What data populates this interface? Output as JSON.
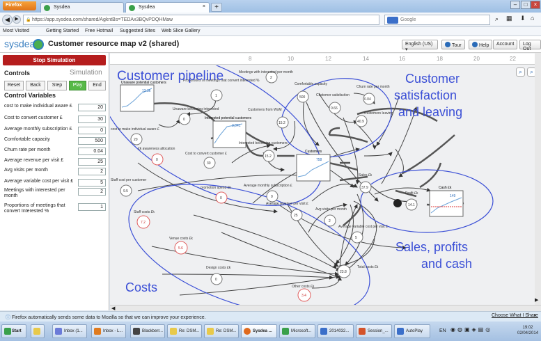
{
  "browser": {
    "app_button": "Firefox",
    "tabs": [
      {
        "label": "Sysdea"
      },
      {
        "label": "Sysdea"
      }
    ],
    "new_tab": "+",
    "url": "https://app.sysdea.com/shared/AgkntBs=TEDAx3BQvPDQHMaw",
    "search_placeholder": "Google",
    "bookmarks": [
      "Most Visited",
      "Getting Started",
      "Free Hotmail",
      "Suggested Sites",
      "Web Slice Gallery"
    ]
  },
  "app": {
    "logo": "sysdea",
    "title": "Customer resource map v2 (shared)",
    "language": "English (US)",
    "tour": "Tour",
    "help": "Help",
    "account": "Account",
    "logout": "Log Out"
  },
  "left": {
    "stop": "Stop Simulation",
    "controls": "Controls",
    "simulation": "Simulation",
    "sim_buttons": [
      "Reset",
      "Back",
      "Step",
      "Play",
      "End"
    ],
    "control_vars_title": "Control Variables",
    "variables": [
      {
        "label": "cost to make individual aware £",
        "value": "20"
      },
      {
        "label": "Cost to convert customer £",
        "value": "30"
      },
      {
        "label": "Average monthly subscription £",
        "value": "0"
      },
      {
        "label": "Comfortable capacity",
        "value": "500"
      },
      {
        "label": "Churn rate per month",
        "value": "0.04"
      },
      {
        "label": "Average revenue per visit £",
        "value": "25"
      },
      {
        "label": "Avg visits per month",
        "value": "2"
      },
      {
        "label": "Average variable cost per visit £",
        "value": "5"
      },
      {
        "label": "Meetings with interested per month",
        "value": "2"
      },
      {
        "label": "Proportions of meetings that convert Interested %",
        "value": "1"
      }
    ]
  },
  "ruler": [
    "8",
    "10",
    "12",
    "14",
    "16",
    "18",
    "20",
    "22"
  ],
  "annotations": {
    "pipeline": "Customer pipeline",
    "satisfaction": [
      "Customer",
      "satisfaction",
      "and leaving"
    ],
    "sales": [
      "Sales, profits",
      "and cash"
    ],
    "costs": "Costs"
  },
  "nodes": {
    "unaware": {
      "label": "Unaware potential customers",
      "value": "13.3k"
    },
    "interested": {
      "label": "Interested potential customers",
      "value": "3,041"
    },
    "customers": {
      "label": "Customers",
      "value": "758"
    },
    "cash": {
      "label": "Cash £k",
      "value": "149"
    },
    "proportion": {
      "label": "Proportions of meetings that convert interested %",
      "value": "1"
    },
    "meetings": {
      "label": "Meetings with interested per month",
      "value": "2"
    },
    "capacity": {
      "label": "Comfortable capacity",
      "value": "500"
    },
    "churn": {
      "label": "Churn rate per month",
      "value": "0.04"
    },
    "satisfaction": {
      "label": "Customer satisfaction",
      "value": "0.66"
    },
    "leaving": {
      "label": "Customers leaving",
      "value": "40.9"
    },
    "from_wom": {
      "label": "Customers from WoM",
      "value": "15.2"
    },
    "becoming_interested": {
      "label": "Unaware becoming interested",
      "value": "0"
    },
    "becoming_customers": {
      "label": "Interested becoming customers",
      "value": "15.2"
    },
    "cost_aware": {
      "label": "cost to make individual aware £",
      "value": "20"
    },
    "awareness": {
      "label": "£k awareness allocation",
      "value": "0"
    },
    "cost_convert": {
      "label": "Cost to convert customer £",
      "value": "30"
    },
    "staff_per_customer": {
      "label": "Staff cost per customer",
      "value": "9.5"
    },
    "promo": {
      "label": "promotion spend £k",
      "value": "0"
    },
    "subscription": {
      "label": "Average monthly subscription £",
      "value": "0"
    },
    "sales": {
      "label": "Sales £k",
      "value": "37.9"
    },
    "profit": {
      "label": "Profit £k",
      "value": "14.1"
    },
    "staff": {
      "label": "Staff costs £k",
      "value": "7.2"
    },
    "revenue_visit": {
      "label": "Average revenue per visit £",
      "value": "25"
    },
    "visits": {
      "label": "Avg visits per month",
      "value": "2"
    },
    "var_cost": {
      "label": "Average variable cost per visit £",
      "value": "5"
    },
    "venue": {
      "label": "Venue costs £k",
      "value": "5.6"
    },
    "design": {
      "label": "Design costs £k",
      "value": "0"
    },
    "other": {
      "label": "Other costs £k",
      "value": "3.4"
    },
    "total": {
      "label": "Total costs £k",
      "value": "23.8"
    }
  },
  "status": {
    "notification": "Firefox automatically sends some data to Mozilla so that we can improve your experience.",
    "choose": "Choose What I Share"
  },
  "taskbar": {
    "start": "Start",
    "items": [
      "Inbox (1...",
      "Inbox - L...",
      "Blackberr...",
      "Re: DSM...",
      "Re: DSM...",
      "Sysdea ...",
      "Microsoft...",
      "2014032...",
      "Session_...",
      "AutoPlay"
    ],
    "lang": "EN",
    "time": "19:02",
    "date": "02/04/2014"
  },
  "colors": {
    "annotation": "#3b4fd6",
    "stop": "#b51d1d",
    "play": "#57b948",
    "logo": "#3a7fc0"
  }
}
